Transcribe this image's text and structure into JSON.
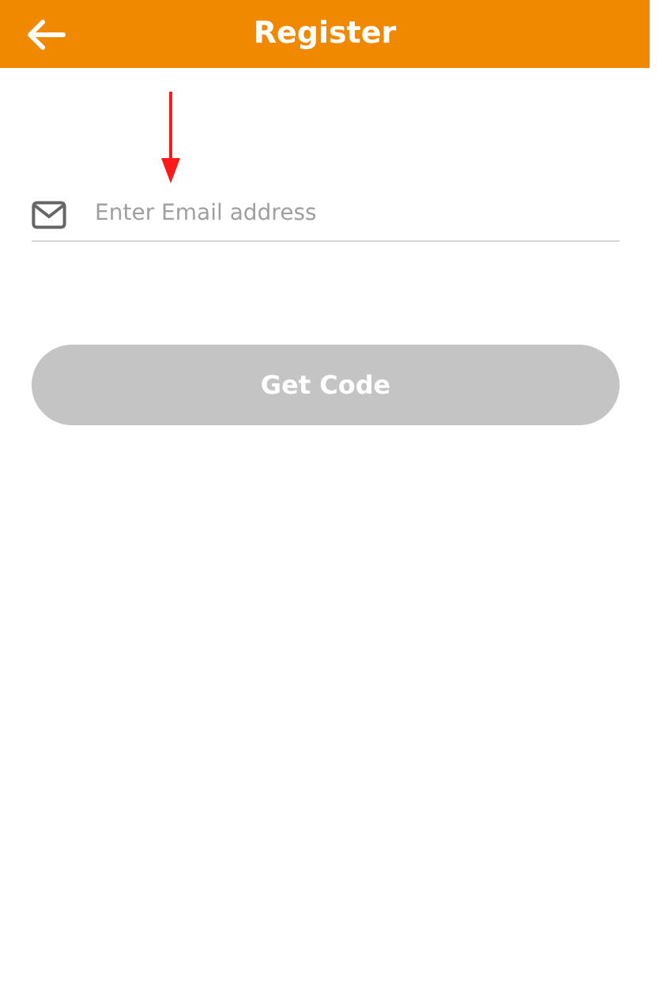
{
  "header": {
    "title": "Register"
  },
  "email_field": {
    "placeholder": "Enter Email address"
  },
  "get_code_button": {
    "label": "Get Code",
    "disabled": true
  }
}
